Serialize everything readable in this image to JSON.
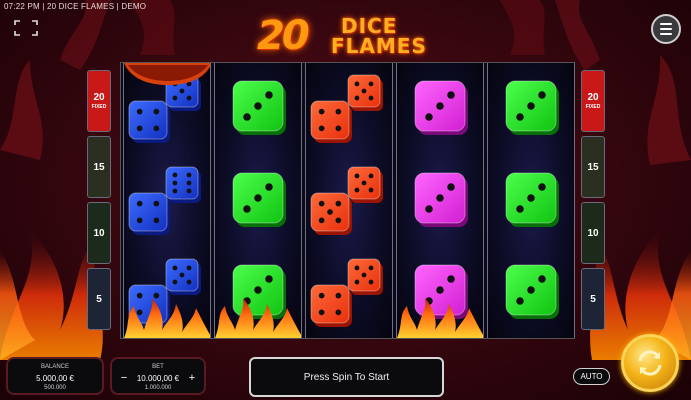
{
  "topbar": {
    "status": "07:22 PM | 20 DICE FLAMES | DEMO"
  },
  "logo": {
    "number": "20",
    "word1": "DICE",
    "word2": "FLAMES"
  },
  "paylines": {
    "left": [
      {
        "label": "20",
        "sub": "FIXED",
        "active": true
      },
      {
        "label": "15",
        "sub": "",
        "active": false
      },
      {
        "label": "10",
        "sub": "",
        "active": false
      },
      {
        "label": "5",
        "sub": "",
        "active": false
      }
    ],
    "right": [
      {
        "label": "20",
        "sub": "FIXED",
        "active": true
      },
      {
        "label": "15",
        "sub": "",
        "active": false
      },
      {
        "label": "10",
        "sub": "",
        "active": false
      },
      {
        "label": "5",
        "sub": "",
        "active": false
      }
    ]
  },
  "reels": [
    {
      "symbols": [
        {
          "type": "double",
          "color": "blue",
          "front": 4,
          "back": 5
        },
        {
          "type": "double",
          "color": "blue",
          "front": 4,
          "back": 6
        },
        {
          "type": "double",
          "color": "blue",
          "front": 4,
          "back": 5
        }
      ]
    },
    {
      "symbols": [
        {
          "type": "single",
          "color": "green",
          "front": 3
        },
        {
          "type": "single",
          "color": "green",
          "front": 3
        },
        {
          "type": "single",
          "color": "green",
          "front": 3
        }
      ]
    },
    {
      "symbols": [
        {
          "type": "double",
          "color": "red",
          "front": 4,
          "back": 5
        },
        {
          "type": "double",
          "color": "red",
          "front": 5,
          "back": 5
        },
        {
          "type": "double",
          "color": "red",
          "front": 4,
          "back": 5
        }
      ]
    },
    {
      "symbols": [
        {
          "type": "single",
          "color": "magenta",
          "front": 3
        },
        {
          "type": "single",
          "color": "magenta",
          "front": 3
        },
        {
          "type": "single",
          "color": "magenta",
          "front": 3
        }
      ]
    },
    {
      "symbols": [
        {
          "type": "single",
          "color": "green",
          "front": 3
        },
        {
          "type": "single",
          "color": "green",
          "front": 3
        },
        {
          "type": "single",
          "color": "green",
          "front": 3
        }
      ]
    }
  ],
  "reel_flames": [
    true,
    true,
    false,
    true,
    false
  ],
  "balance": {
    "label": "BALANCE",
    "value": "5.000,00 €",
    "sub": "500.000"
  },
  "bet": {
    "label": "BET",
    "value": "10.000,00 €",
    "sub": "1.000.000",
    "minus": "−",
    "plus": "+"
  },
  "message": "Press Spin To Start",
  "auto_label": "AUTO",
  "icons": {
    "fullscreen": "fullscreen-icon",
    "menu": "hamburger-menu-icon",
    "spin": "spin-arrows-icon"
  },
  "colors": {
    "blue": [
      "#3d6cff",
      "#1230c0",
      "#0a1a80"
    ],
    "green": [
      "#4cff4c",
      "#12c412",
      "#067006"
    ],
    "red": [
      "#ff6a3a",
      "#e8300c",
      "#9a1400"
    ],
    "magenta": [
      "#ff66ff",
      "#d21fd2",
      "#7a0a7a"
    ],
    "spin_gold": "#f4b418"
  }
}
